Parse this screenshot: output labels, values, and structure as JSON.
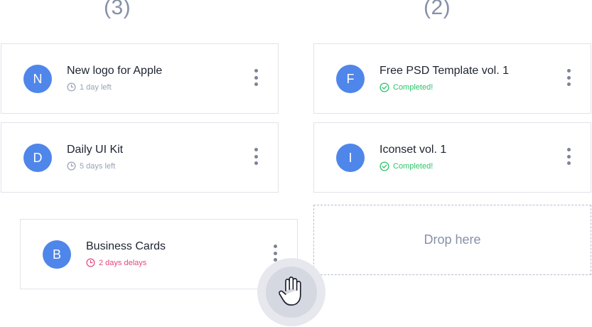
{
  "columns": [
    {
      "count": "(3)"
    },
    {
      "count": "(2)"
    }
  ],
  "cards": [
    {
      "initial": "N",
      "title": "New logo for Apple",
      "status": "1 day left"
    },
    {
      "initial": "D",
      "title": "Daily UI Kit",
      "status": "5 days left"
    },
    {
      "initial": "B",
      "title": "Business Cards",
      "status": "2 days delays"
    },
    {
      "initial": "F",
      "title": "Free PSD Template vol. 1",
      "status": "Completed!"
    },
    {
      "initial": "I",
      "title": "Iconset vol. 1",
      "status": "Completed!"
    }
  ],
  "drop_zone": {
    "label": "Drop here"
  },
  "icons": {
    "time": "clock-icon",
    "done": "check-circle-icon",
    "menu": "more-vertical-icon",
    "cursor": "grab-hand-icon"
  },
  "colors": {
    "avatar": "#4f86ea",
    "completed": "#2ec26a",
    "delayed": "#e8457a",
    "muted": "#9aa1b5"
  }
}
